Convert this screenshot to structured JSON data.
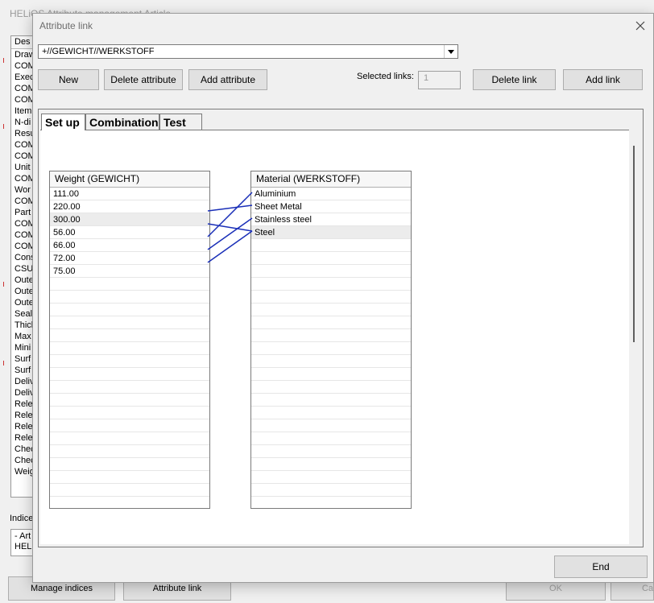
{
  "background": {
    "title": "HELiOS Attribute management Article",
    "list_header": "Des",
    "list_items": [
      "Draw",
      "COM",
      "Exec",
      "COM",
      "COM",
      "Item",
      "N-di",
      "Resu",
      "COM",
      "COM",
      "Unit",
      "COM",
      "Wor",
      "COM",
      "Part",
      "COM",
      "COM",
      "COM",
      "Cons",
      "CSU",
      "Oute",
      "Oute",
      "Oute",
      "Seal",
      "Thick",
      "Max",
      "Mini",
      "Surf",
      "Surf",
      "Deliv",
      "Deliv",
      "Rele",
      "Rele",
      "Rele",
      "Rele",
      "Chec",
      "Chec",
      "Weig"
    ],
    "indices_label": "Indice",
    "indices_lines": [
      "- Art",
      "HEL"
    ],
    "manage_indices_label": "Manage indices",
    "attribute_link_label": "Attribute link",
    "ok_label": "OK",
    "cancel_label": "Ca"
  },
  "dialog": {
    "title": "Attribute link",
    "close_icon": "close-icon",
    "attribute_select_value": "+//GEWICHT//WERKSTOFF",
    "buttons": {
      "new": "New",
      "delete_attribute": "Delete attribute",
      "add_attribute": "Add attribute",
      "delete_link": "Delete link",
      "add_link": "Add link",
      "end": "End"
    },
    "selected_links_label": "Selected links:",
    "selected_links_value": "1",
    "tabs": [
      "Set up",
      "Combination",
      "Test"
    ],
    "active_tab": "Set up",
    "left_list": {
      "header": "Weight (GEWICHT)",
      "items": [
        "111.00",
        "220.00",
        "300.00",
        "56.00",
        "66.00",
        "72.00",
        "75.00"
      ],
      "selected_index": 2
    },
    "right_list": {
      "header": "Material (WERKSTOFF)",
      "items": [
        "Aluminium",
        "Sheet Metal",
        "Stainless steel",
        "Steel"
      ],
      "selected_index": 3
    },
    "links": [
      {
        "from": "220.00",
        "to": "Sheet Metal"
      },
      {
        "from": "300.00",
        "to": "Steel"
      },
      {
        "from": "56.00",
        "to": "Aluminium"
      },
      {
        "from": "66.00",
        "to": "Stainless steel"
      },
      {
        "from": "72.00",
        "to": "Steel"
      }
    ],
    "link_color": "#1a2fb8"
  }
}
